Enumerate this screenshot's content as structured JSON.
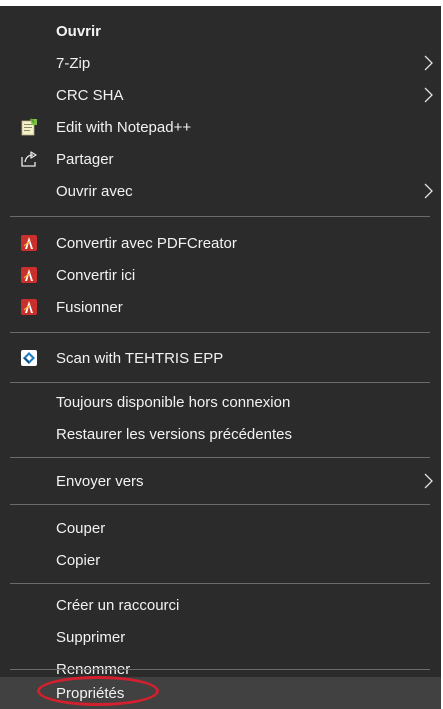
{
  "menu": {
    "items": [
      {
        "label": "Ouvrir",
        "bold": true
      },
      {
        "label": "7-Zip",
        "has_submenu": true
      },
      {
        "label": "CRC SHA",
        "has_submenu": true
      },
      {
        "label": "Edit with Notepad++",
        "icon": "notepad-plus-plus-icon"
      },
      {
        "label": "Partager",
        "icon": "share-icon"
      },
      {
        "label": "Ouvrir avec",
        "has_submenu": true
      },
      {
        "label": "Convertir avec PDFCreator",
        "icon": "pdfcreator-icon"
      },
      {
        "label": "Convertir ici",
        "icon": "pdfcreator-icon"
      },
      {
        "label": "Fusionner",
        "icon": "pdfcreator-icon"
      },
      {
        "label": "Scan with TEHTRIS EPP",
        "icon": "tehtris-icon"
      },
      {
        "label": "Toujours disponible hors connexion"
      },
      {
        "label": "Restaurer les versions précédentes"
      },
      {
        "label": "Envoyer vers",
        "has_submenu": true
      },
      {
        "label": "Couper"
      },
      {
        "label": "Copier"
      },
      {
        "label": "Créer un raccourci"
      },
      {
        "label": "Supprimer"
      },
      {
        "label": "Renommer"
      },
      {
        "label": "Propriétés",
        "highlighted": true,
        "annotated": true
      }
    ]
  },
  "colors": {
    "menu_background": "#2b2b2b",
    "menu_text": "#f2f2f2",
    "separator": "#6b6b6b",
    "highlight": "#414141",
    "annotation": "#d2202e"
  }
}
